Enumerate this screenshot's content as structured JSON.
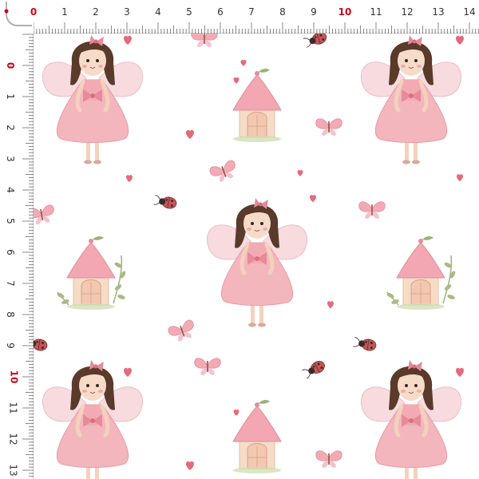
{
  "ruler": {
    "top_labels": [
      "0",
      "1",
      "2",
      "3",
      "4",
      "5",
      "6",
      "7",
      "8",
      "9",
      "10",
      "11",
      "12",
      "13",
      "14"
    ],
    "left_labels": [
      "0",
      "1",
      "2",
      "3",
      "4",
      "5",
      "6",
      "7",
      "8",
      "9",
      "10",
      "11",
      "12",
      "13"
    ],
    "highlight_color": "#d0021b",
    "background": "#ffffff",
    "tick_color": "#555555"
  },
  "pattern": {
    "background": "#ffffff",
    "motifs": [
      "fairy-girl",
      "fairy-house",
      "butterfly",
      "ladybug",
      "heart"
    ],
    "colors": {
      "dress": "#f4b6bd",
      "dress_dark": "#e79aa6",
      "hair": "#5a3a2a",
      "wings": "#f7d8dc",
      "skin": "#f6dcc8",
      "house_wall": "#f6dcc6",
      "house_roof": "#f2a7b2",
      "leaf": "#9fb07a",
      "heart": "#e46a7a",
      "ladybug": "#b84a4a"
    }
  }
}
